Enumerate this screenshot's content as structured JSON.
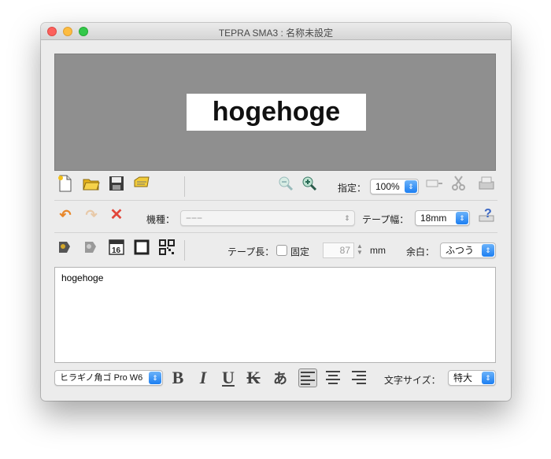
{
  "window": {
    "title": "TEPRA SMA3 : 名称未設定"
  },
  "preview": {
    "label_text": "hogehoge"
  },
  "toolbar1": {
    "icons": [
      "new-document-icon",
      "open-folder-icon",
      "save-icon",
      "print-settings-icon"
    ],
    "zoom_out_icon": "zoom-out-icon",
    "zoom_in_icon": "zoom-in-icon",
    "zoom_label": "指定：",
    "zoom_value": "100%",
    "right_icons": [
      "tape-cut-icon",
      "scissors-icon",
      "printer-icon"
    ]
  },
  "toolbar2": {
    "undo_icon": "undo-icon",
    "redo_icon": "redo-icon",
    "delete_icon": "delete-icon",
    "model_label": "機種：",
    "model_value": "−−−",
    "tape_width_label": "テープ幅：",
    "tape_width_value": "18mm",
    "help_icon": "help-icon"
  },
  "toolbar3": {
    "icons": [
      "stamp-icon",
      "stamp-disabled-icon",
      "calendar-icon",
      "frame-icon",
      "qr-code-icon"
    ],
    "calendar_day": "16",
    "tape_length_label": "テープ長：",
    "fixed_label": "固定",
    "length_value": "87",
    "length_unit": "mm",
    "margin_label": "余白：",
    "margin_value": "ふつう"
  },
  "editor": {
    "text": "hogehoge"
  },
  "format_bar": {
    "font_value": "ヒラギノ角ゴ Pro W6",
    "bold": "B",
    "italic": "I",
    "underline": "U",
    "strike": "K",
    "vertical": "あ",
    "font_size_label": "文字サイズ：",
    "font_size_value": "特大"
  },
  "colors": {
    "accent": "#1d7ff2",
    "preview_bg": "#8f8f8f",
    "delete_red": "#e2473b",
    "undo_orange": "#e8872a"
  }
}
